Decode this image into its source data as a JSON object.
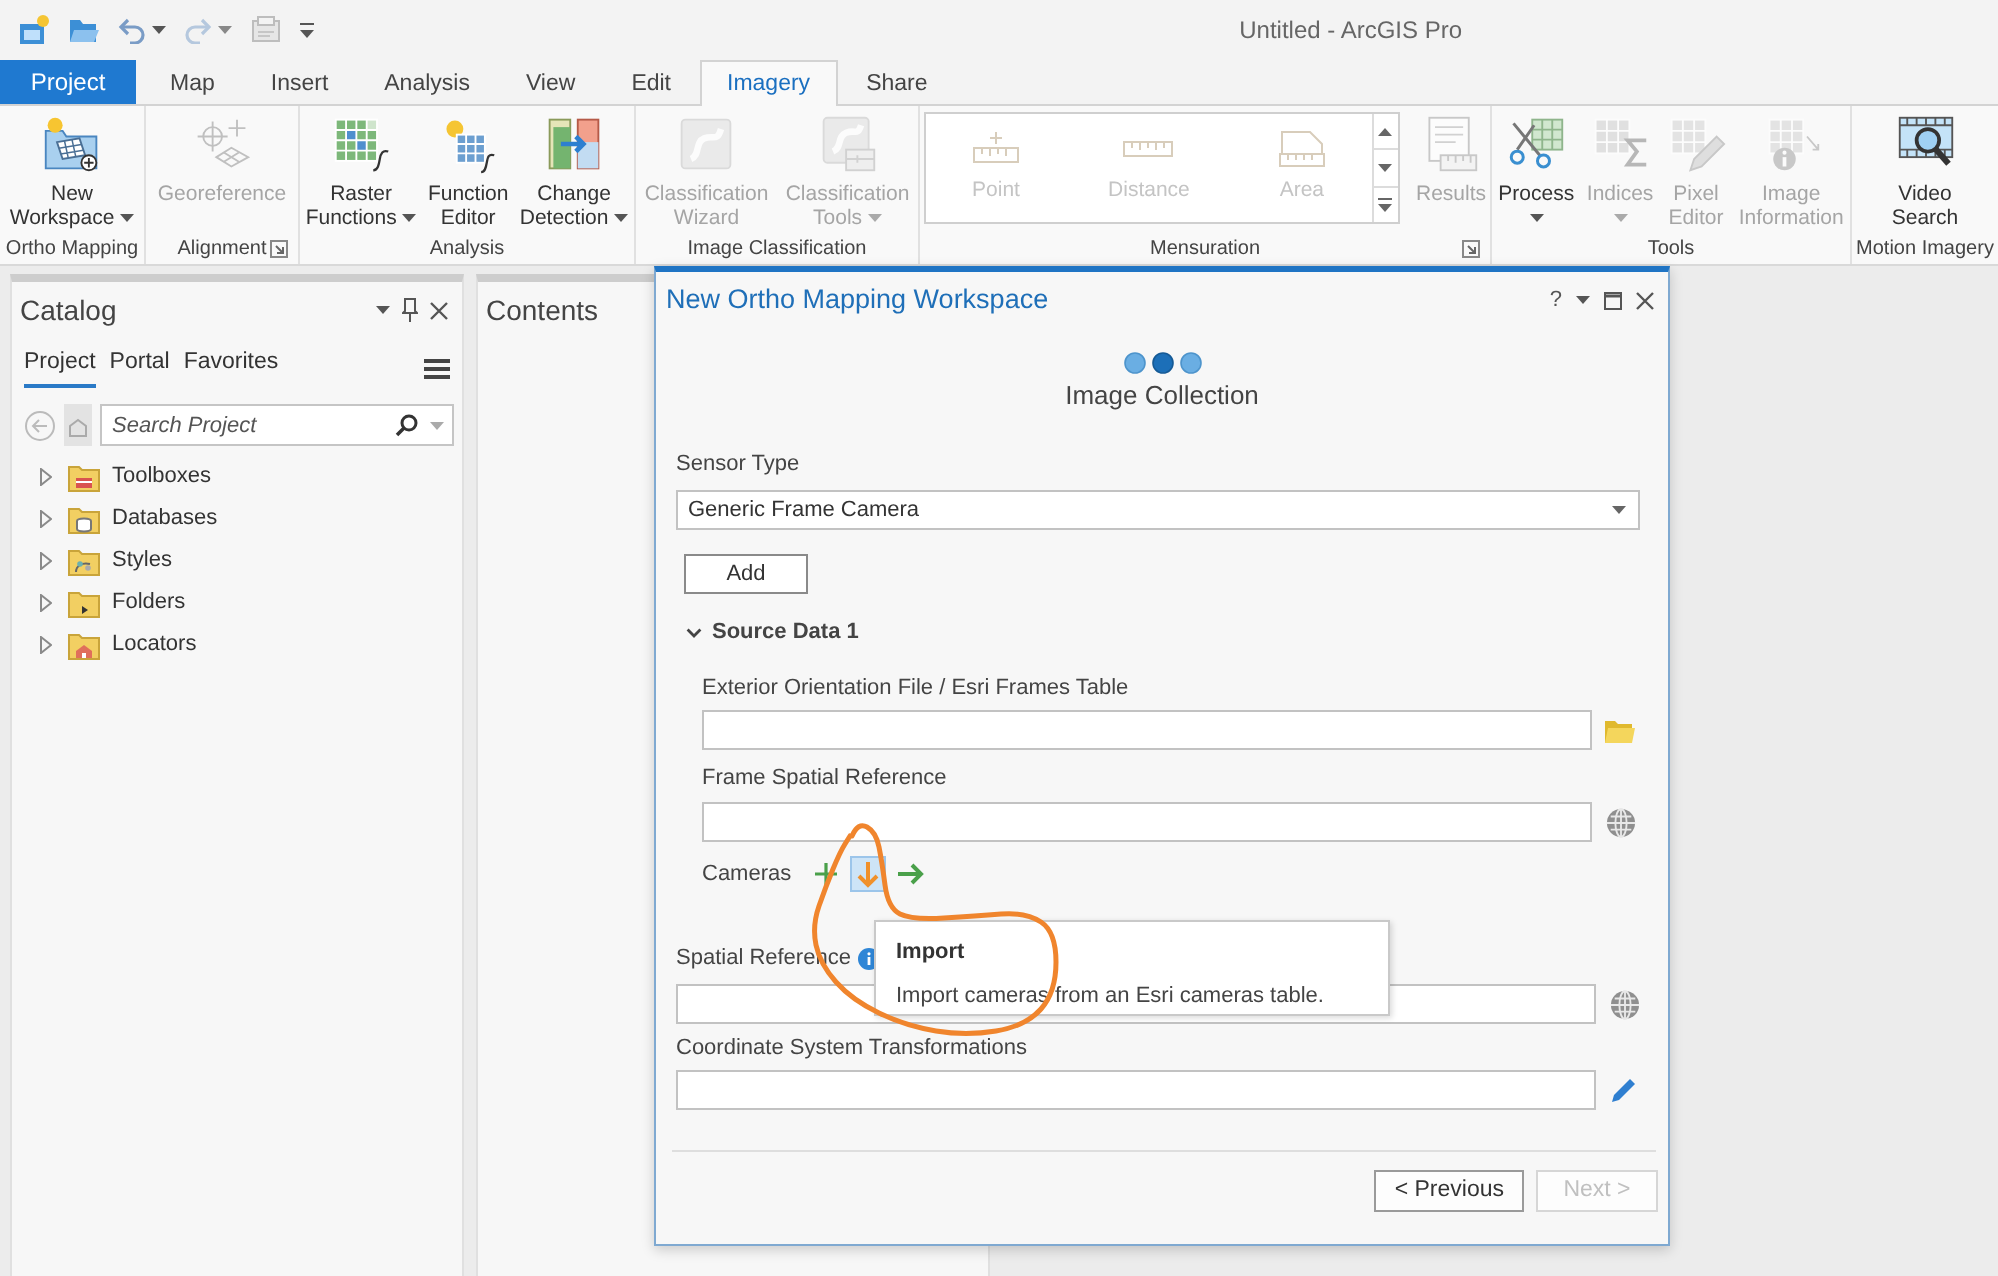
{
  "window": {
    "title": "Untitled - ArcGIS Pro"
  },
  "ribbon": {
    "tabs": [
      {
        "label": "Project",
        "kind": "backstage",
        "selected": false
      },
      {
        "label": "Map",
        "kind": "tab",
        "selected": false
      },
      {
        "label": "Insert",
        "kind": "tab",
        "selected": false
      },
      {
        "label": "Analysis",
        "kind": "tab",
        "selected": false
      },
      {
        "label": "View",
        "kind": "tab",
        "selected": false
      },
      {
        "label": "Edit",
        "kind": "tab",
        "selected": false
      },
      {
        "label": "Imagery",
        "kind": "tab",
        "selected": true
      },
      {
        "label": "Share",
        "kind": "tab",
        "selected": false
      }
    ],
    "groups": [
      {
        "label": "Ortho Mapping",
        "buttons": [
          {
            "label": "New Workspace",
            "dropdown": true,
            "disabled": false
          }
        ]
      },
      {
        "label": "Alignment",
        "launcher": true,
        "buttons": [
          {
            "label": "Georeference",
            "dropdown": false,
            "disabled": true
          }
        ]
      },
      {
        "label": "Analysis",
        "buttons": [
          {
            "label": "Raster Functions",
            "dropdown": true,
            "disabled": false
          },
          {
            "label": "Function Editor",
            "dropdown": false,
            "disabled": false
          },
          {
            "label": "Change Detection",
            "dropdown": true,
            "disabled": false
          }
        ]
      },
      {
        "label": "Image Classification",
        "buttons": [
          {
            "label": "Classification Wizard",
            "dropdown": false,
            "disabled": true
          },
          {
            "label": "Classification Tools",
            "dropdown": true,
            "disabled": true
          }
        ]
      },
      {
        "label": "Mensuration",
        "launcher": true,
        "gallery": [
          {
            "label": "Point",
            "disabled": true
          },
          {
            "label": "Distance",
            "disabled": true
          },
          {
            "label": "Area",
            "disabled": true
          }
        ],
        "buttons": [
          {
            "label": "Results",
            "dropdown": false,
            "disabled": true
          }
        ]
      },
      {
        "label": "Tools",
        "buttons": [
          {
            "label": "Process",
            "dropdown": true,
            "disabled": false
          },
          {
            "label": "Indices",
            "dropdown": true,
            "disabled": true
          },
          {
            "label": "Pixel Editor",
            "dropdown": false,
            "disabled": true
          },
          {
            "label": "Image Information",
            "dropdown": false,
            "disabled": true
          }
        ]
      },
      {
        "label": "Motion Imagery",
        "buttons": [
          {
            "label": "Video Search",
            "dropdown": false,
            "disabled": false
          }
        ]
      }
    ]
  },
  "catalog": {
    "title": "Catalog",
    "tabs": [
      {
        "label": "Project",
        "selected": true
      },
      {
        "label": "Portal",
        "selected": false
      },
      {
        "label": "Favorites",
        "selected": false
      }
    ],
    "search": {
      "placeholder": "Search Project"
    },
    "items": [
      {
        "label": "Toolboxes",
        "expanded": false
      },
      {
        "label": "Databases",
        "expanded": false
      },
      {
        "label": "Styles",
        "expanded": false
      },
      {
        "label": "Folders",
        "expanded": false
      },
      {
        "label": "Locators",
        "expanded": false
      }
    ]
  },
  "contents": {
    "title": "Contents"
  },
  "dialog": {
    "title": "New Ortho Mapping Workspace",
    "help": "?",
    "steps": [
      {
        "selected": false
      },
      {
        "selected": true
      },
      {
        "selected": false
      }
    ],
    "step_title": "Image Collection",
    "sensor_type": {
      "label": "Sensor Type",
      "value": "Generic Frame Camera"
    },
    "add_button": {
      "label": "Add"
    },
    "source": {
      "title": "Source Data 1",
      "expanded": true,
      "fields": [
        {
          "label": "Exterior Orientation File / Esri Frames Table",
          "kind": "file"
        },
        {
          "label": "Frame Spatial Reference",
          "kind": "globe"
        }
      ],
      "cameras": {
        "label": "Cameras",
        "tools": [
          {
            "highlighted": false
          },
          {
            "highlighted": true
          },
          {
            "highlighted": false
          }
        ]
      }
    },
    "fields": [
      {
        "label": "Spatial Reference",
        "kind": "globe",
        "info": true
      },
      {
        "label": "Coordinate System Transformations",
        "kind": "edit",
        "info": false
      }
    ],
    "buttons": [
      {
        "label": "< Previous",
        "disabled": false
      },
      {
        "label": "Next >",
        "disabled": true
      }
    ],
    "tooltip": {
      "title": "Import",
      "text": "Import cameras from an Esri cameras table."
    },
    "annotations": [
      {
        "kind": "freehand-loop"
      }
    ]
  }
}
